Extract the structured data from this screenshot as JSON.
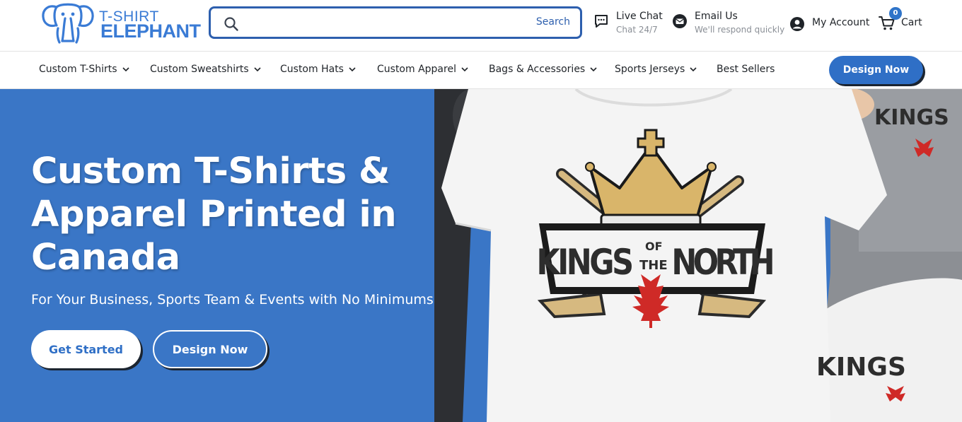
{
  "brand": {
    "logo_line1": "T-SHIRT",
    "logo_line2": "ELEPHANT",
    "accent_color": "#3a7bd5"
  },
  "header": {
    "search": {
      "placeholder": "",
      "button_label": "Search"
    },
    "live_chat": {
      "title": "Live Chat",
      "subtitle": "Chat 24/7",
      "icon": "chat-icon"
    },
    "email_us": {
      "title": "Email Us",
      "subtitle": "We'll respond quickly",
      "icon": "mail-icon"
    },
    "my_account": {
      "title": "My Account",
      "icon": "user-icon"
    },
    "cart": {
      "title": "Cart",
      "count": "0",
      "icon": "cart-icon"
    }
  },
  "nav": {
    "items": [
      {
        "label": "Custom T-Shirts",
        "has_dropdown": true
      },
      {
        "label": "Custom Sweatshirts",
        "has_dropdown": true
      },
      {
        "label": "Custom Hats",
        "has_dropdown": true
      },
      {
        "label": "Custom Apparel",
        "has_dropdown": true
      },
      {
        "label": "Bags & Accessories",
        "has_dropdown": true
      },
      {
        "label": "Sports Jerseys",
        "has_dropdown": true
      },
      {
        "label": "Best Sellers",
        "has_dropdown": false
      }
    ],
    "cta_label": "Design Now"
  },
  "hero": {
    "title": "Custom T-Shirts & Apparel Printed in Canada",
    "subtitle": "For Your Business, Sports Team & Events with No Minimums",
    "primary_button": "Get Started",
    "secondary_button": "Design Now",
    "background_color": "#3a76c6",
    "shirt_graphic": {
      "word1": "KINGS",
      "word2": "OF",
      "word3": "THE",
      "word4": "NORTH"
    }
  }
}
